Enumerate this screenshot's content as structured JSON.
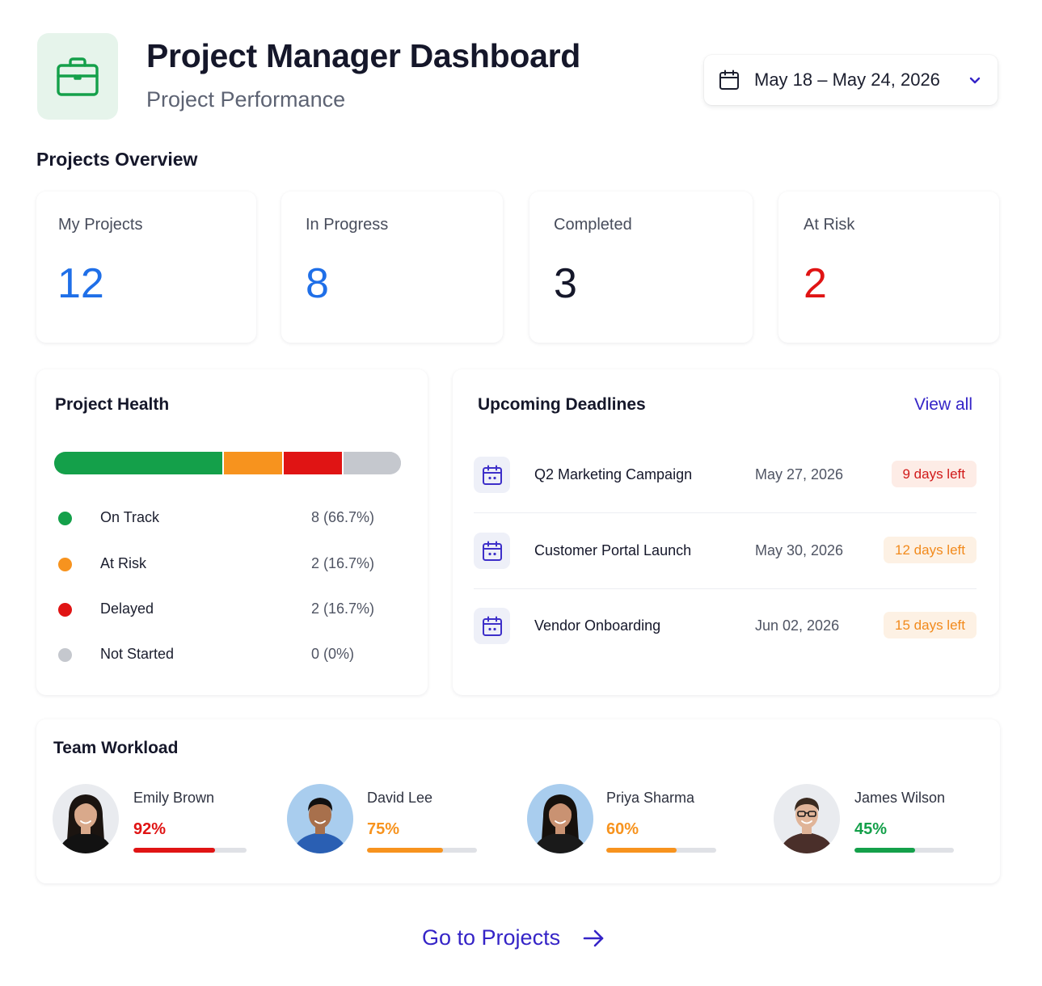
{
  "header": {
    "title": "Project Manager Dashboard",
    "subtitle": "Project Performance",
    "app_icon": "briefcase-icon",
    "date_range": "May 18 – May 24, 2026"
  },
  "overview": {
    "title": "Projects Overview",
    "cards": [
      {
        "label": "My Projects",
        "value": "12",
        "color": "#1f6fe8"
      },
      {
        "label": "In Progress",
        "value": "8",
        "color": "#1f6fe8"
      },
      {
        "label": "Completed",
        "value": "3",
        "color": "#15172a"
      },
      {
        "label": "At Risk",
        "value": "2",
        "color": "#e01414"
      }
    ]
  },
  "health": {
    "title": "Project Health",
    "items": [
      {
        "label": "On Track",
        "value": "8 (66.7%)",
        "share": 0.486,
        "color": "#14a04a"
      },
      {
        "label": "At Risk",
        "value": "2 (16.7%)",
        "share": 0.172,
        "color": "#f7931e"
      },
      {
        "label": "Delayed",
        "value": "2 (16.7%)",
        "share": 0.172,
        "color": "#e01414"
      },
      {
        "label": "Not Started",
        "value": "0 (0%)",
        "share": 0.17,
        "color": "#c5c8ce"
      }
    ]
  },
  "deadlines": {
    "title": "Upcoming Deadlines",
    "view_all": "View all",
    "items": [
      {
        "name": "Q2 Marketing Campaign",
        "date": "May 27, 2026",
        "badge": "9 days left",
        "badge_color": "#d11a1a",
        "badge_bg": "#fdece6"
      },
      {
        "name": "Customer Portal Launch",
        "date": "May 30, 2026",
        "badge": "12 days left",
        "badge_color": "#f28a1c",
        "badge_bg": "#fdf1e4"
      },
      {
        "name": "Vendor Onboarding",
        "date": "Jun 02, 2026",
        "badge": "15 days left",
        "badge_color": "#f28a1c",
        "badge_bg": "#fdf1e4"
      }
    ]
  },
  "workload": {
    "title": "Team Workload",
    "members": [
      {
        "name": "Emily Brown",
        "percent": "92%",
        "level": 0.72,
        "color": "#e01414",
        "avatar_bg": "#e9ebef",
        "skin": "#d9a98b",
        "hair": "#1b1410",
        "shirt": "#121212"
      },
      {
        "name": "David Lee",
        "percent": "75%",
        "level": 0.69,
        "color": "#f7931e",
        "avatar_bg": "#a9cdee",
        "skin": "#a8704c",
        "hair": "#121010",
        "shirt": "#2a5fb3"
      },
      {
        "name": "Priya Sharma",
        "percent": "60%",
        "level": 0.64,
        "color": "#f7931e",
        "avatar_bg": "#a9cdee",
        "skin": "#c99272",
        "hair": "#16110d",
        "shirt": "#1a1a1a"
      },
      {
        "name": "James Wilson",
        "percent": "45%",
        "level": 0.61,
        "color": "#14a04a",
        "avatar_bg": "#e9ebef",
        "skin": "#e0b498",
        "hair": "#3a2a1f",
        "shirt": "#4a2f2a"
      }
    ]
  },
  "footer": {
    "link": "Go to Projects"
  }
}
